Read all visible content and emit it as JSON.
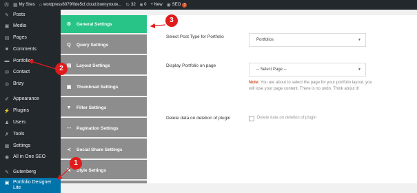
{
  "adminbar": {
    "wp_logo_icon": "wordpress-icon",
    "my_sites": "My Sites",
    "site_url": "wordpress6079f0de5cf.cloud.bunnyroute...",
    "updates_count": "32",
    "comments_count": "0",
    "new_label": "+ New",
    "seo_label": "SEO",
    "seo_badge": "3"
  },
  "sidebar": {
    "items": [
      {
        "label": "Posts",
        "icon": "pin-icon"
      },
      {
        "label": "Media",
        "icon": "media-icon"
      },
      {
        "label": "Pages",
        "icon": "pages-icon"
      },
      {
        "label": "Comments",
        "icon": "comments-icon"
      },
      {
        "label": "Portfolios",
        "icon": "portfolio-icon"
      },
      {
        "label": "Contact",
        "icon": "mail-icon"
      },
      {
        "label": "Brizy",
        "icon": "brizy-icon"
      },
      {
        "label": "Appearance",
        "icon": "brush-icon"
      },
      {
        "label": "Plugins",
        "icon": "plugin-icon"
      },
      {
        "label": "Users",
        "icon": "user-icon"
      },
      {
        "label": "Tools",
        "icon": "wrench-icon"
      },
      {
        "label": "Settings",
        "icon": "settings-icon"
      },
      {
        "label": "All in One SEO",
        "icon": "seo-icon"
      },
      {
        "label": "Gutenberg",
        "icon": "gutenberg-icon"
      }
    ],
    "active": {
      "line1": "Portfolio Designer",
      "line2": "Lite",
      "icon": "portfolio-designer-icon"
    }
  },
  "nav": {
    "items": [
      {
        "label": "General Settings",
        "icon": "gears-icon"
      },
      {
        "label": "Query Settings",
        "icon": "query-icon"
      },
      {
        "label": "Layout Settings",
        "icon": "layout-icon"
      },
      {
        "label": "Thumbnail Settings",
        "icon": "image-icon"
      },
      {
        "label": "Filter Settings",
        "icon": "filter-icon"
      },
      {
        "label": "Pagination Settings",
        "icon": "dots-icon"
      },
      {
        "label": "Social Share Settings",
        "icon": "share-icon"
      },
      {
        "label": "Style Settings",
        "icon": "style-icon"
      }
    ]
  },
  "content": {
    "post_type_label": "Select Post Type for Portfolio",
    "post_type_value": "Portfolios",
    "display_label": "Display Portfolio on page",
    "display_value": "-- Select Page --",
    "note_key": "Note:",
    "note_text": "You are about to select the page for your portfolio layout, you will lose your page content. There is no undo. Think about it!",
    "delete_label": "Delete data on deletion of plugin",
    "delete_checkbox_label": "Delete data on deletion of plugin"
  },
  "annotations": {
    "one": "1",
    "two": "2",
    "three": "3",
    "color": "#e01b1b"
  }
}
